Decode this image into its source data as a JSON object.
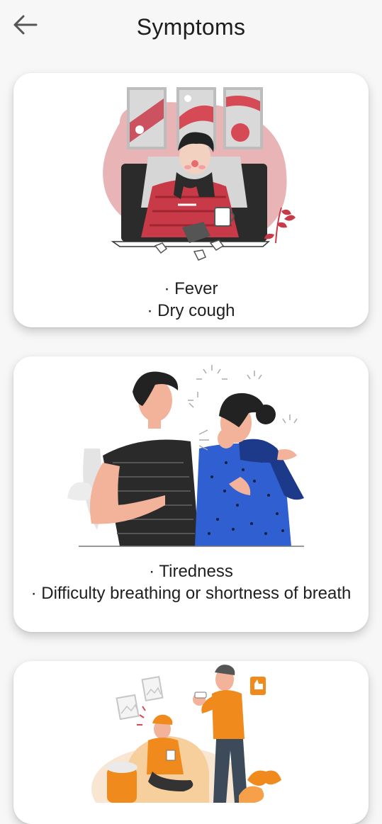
{
  "header": {
    "title": "Symptoms",
    "back_icon": "arrow-left-icon"
  },
  "cards": [
    {
      "illustration": "sick-person-in-bed-illustration",
      "symptoms": [
        "· Fever",
        "· Dry cough"
      ]
    },
    {
      "illustration": "coughing-woman-and-man-illustration",
      "symptoms": [
        "· Tiredness",
        "· Difficulty breathing or shortness of breath"
      ]
    },
    {
      "illustration": "sick-person-with-caregiver-illustration",
      "symptoms": []
    }
  ],
  "colors": {
    "background": "#f7f7f7",
    "card": "#ffffff",
    "accent_red": "#c8303c",
    "accent_blue": "#2f5fd0",
    "accent_orange": "#f08a1c"
  }
}
